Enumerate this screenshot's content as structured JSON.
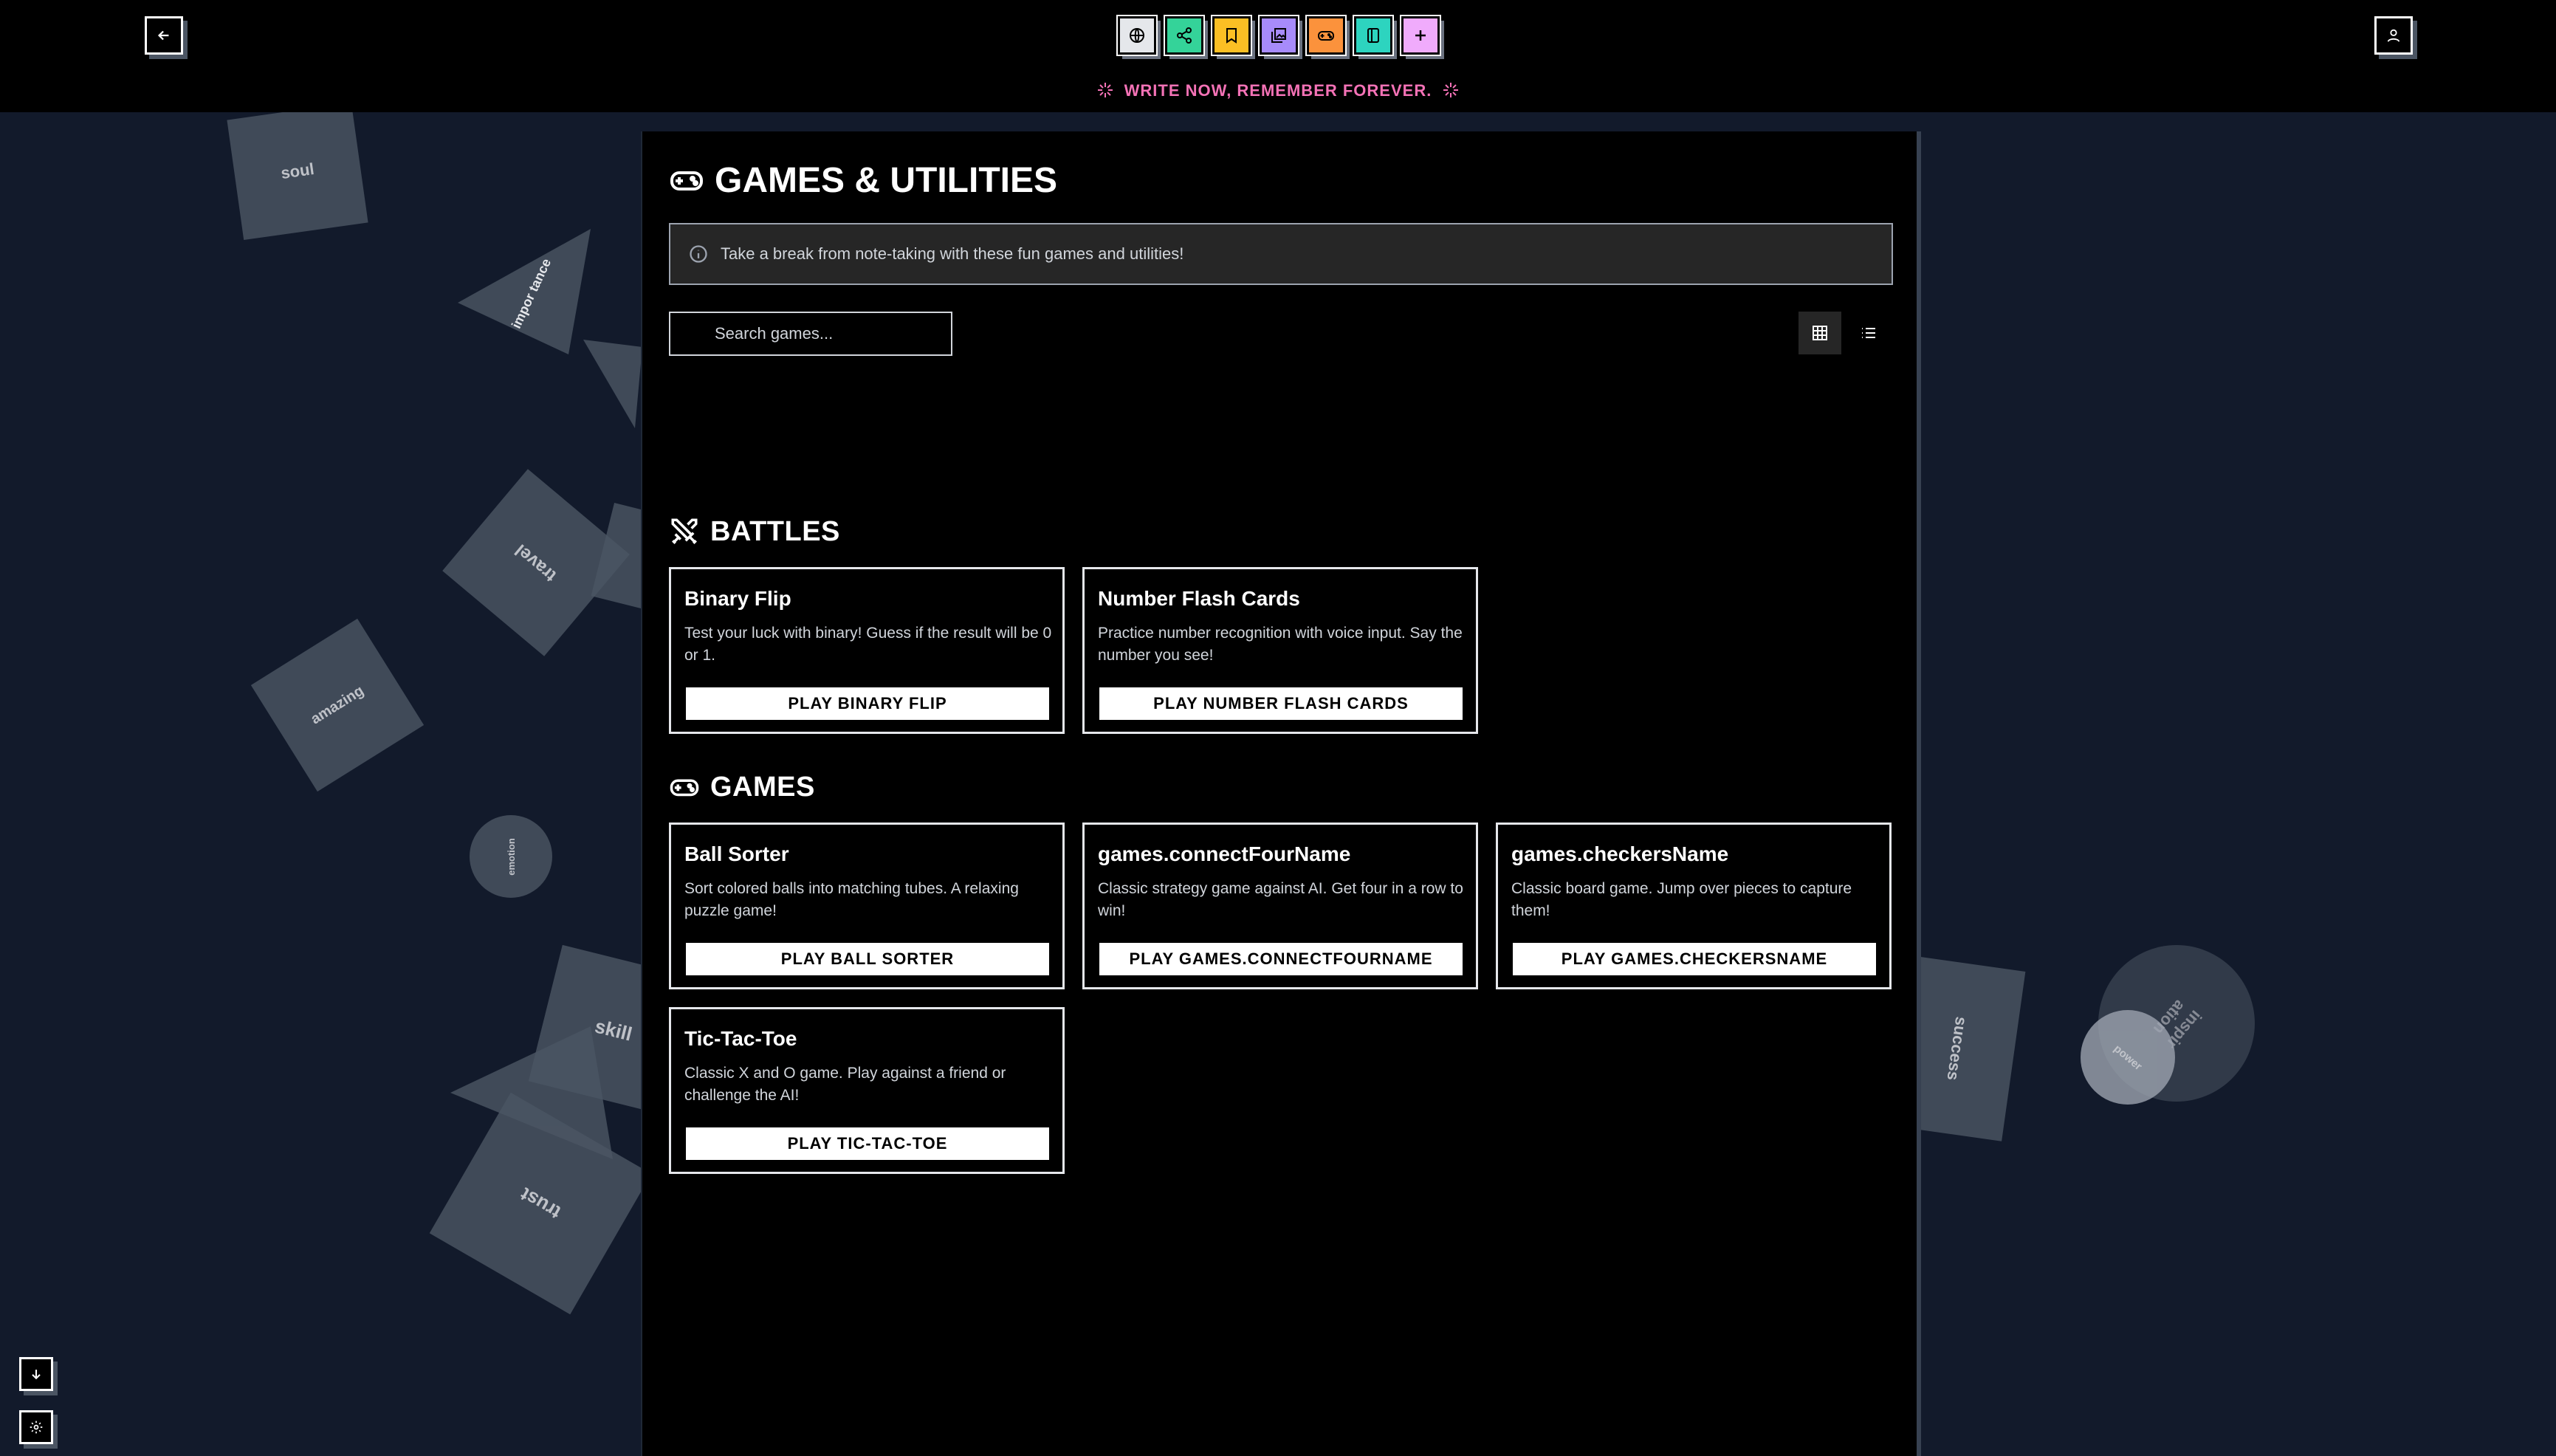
{
  "topbar": {
    "back_icon": "arrow-left-icon",
    "profile_icon": "user-icon",
    "tagline": "WRITE NOW, REMEMBER FOREVER.",
    "tools": [
      {
        "name": "globe",
        "color": "#e5e7eb"
      },
      {
        "name": "share",
        "color": "#34d399"
      },
      {
        "name": "bookmark",
        "color": "#fbbf24"
      },
      {
        "name": "images",
        "color": "#a78bfa"
      },
      {
        "name": "gamepad",
        "color": "#fb923c"
      },
      {
        "name": "notebook",
        "color": "#2dd4bf"
      },
      {
        "name": "plus",
        "color": "#f0abfc"
      }
    ]
  },
  "background_words": [
    "soul",
    "impor tance",
    "travel",
    "amazing",
    "emotion",
    "skill",
    "trust",
    "success",
    "inspir ation",
    "power"
  ],
  "main": {
    "title": "GAMES & UTILITIES",
    "info": "Take a break from note-taking with these fun games and utilities!",
    "search_placeholder": "Search games...",
    "sections": [
      {
        "title": "BATTLES",
        "cards": [
          {
            "title": "Binary Flip",
            "desc": "Test your luck with binary! Guess if the result will be 0 or 1.",
            "button": "PLAY BINARY FLIP"
          },
          {
            "title": "Number Flash Cards",
            "desc": "Practice number recognition with voice input. Say the number you see!",
            "button": "PLAY NUMBER FLASH CARDS"
          }
        ]
      },
      {
        "title": "GAMES",
        "cards": [
          {
            "title": "Ball Sorter",
            "desc": "Sort colored balls into matching tubes. A relaxing puzzle game!",
            "button": "PLAY BALL SORTER"
          },
          {
            "title": "games.connectFourName",
            "desc": "Classic strategy game against AI. Get four in a row to win!",
            "button": "PLAY GAMES.CONNECTFOURNAME"
          },
          {
            "title": "games.checkersName",
            "desc": "Classic board game. Jump over pieces to capture them!",
            "button": "PLAY GAMES.CHECKERSNAME"
          },
          {
            "title": "Tic-Tac-Toe",
            "desc": "Classic X and O game. Play against a friend or challenge the AI!",
            "button": "PLAY TIC-TAC-TOE"
          }
        ]
      }
    ]
  },
  "colors": {
    "accent_pink": "#f472b6",
    "panel": "#000000",
    "background": "#121a2b"
  }
}
